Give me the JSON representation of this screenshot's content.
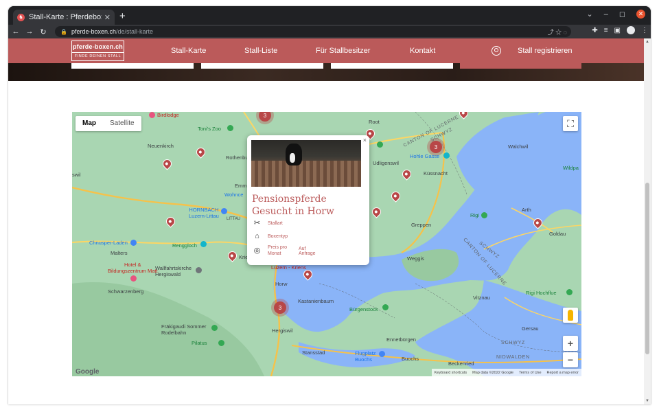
{
  "browser": {
    "tab_title": "Stall-Karte : Pferdeboxen",
    "tab_close": "✕",
    "new_tab": "+",
    "url_host": "pferde-boxen.ch",
    "url_path": "/de/stall-karte",
    "win_min": "–",
    "win_max": "◻",
    "win_close": "✕"
  },
  "header": {
    "logo_line1": "pferde-boxen.ch",
    "logo_line2": "FINDE DEINEN STALL",
    "nav": [
      "Stall-Karte",
      "Stall-Liste",
      "Für Stallbesitzer",
      "Kontakt"
    ],
    "register": "Stall registrieren"
  },
  "map": {
    "type_map": "Map",
    "type_satellite": "Satellite",
    "zoom_in": "+",
    "zoom_out": "−",
    "fullscreen": "⛶",
    "google": "Google",
    "attribution": [
      "Keyboard shortcuts",
      "Map data ©2022 Google",
      "Terms of Use",
      "Report a map error"
    ],
    "clusters": [
      "3",
      "3",
      "3"
    ],
    "places": {
      "birdlodge": "Birdlodge",
      "root": "Root",
      "tonis_zoo": "Toni's Zoo",
      "neuenkirch": "Neuenkirch",
      "rothenburg": "Rothenbu",
      "udligenswil": "Udligenswil",
      "hohle_gasse": "Hohle Gasse",
      "walchwil": "Walchwil",
      "swil": "swil",
      "emmen": "Emm",
      "wohncenter": "Wohnce",
      "kussnacht": "Küssnacht",
      "wildpark": "Wildpa",
      "hornbach": "HORNBACH\nLuzern-Littau",
      "littau": "LITTAU",
      "arth": "Arth",
      "greppen": "Greppen",
      "rigi": "Rigi",
      "goldau": "Goldau",
      "chnusper": "Chnusper-Laden",
      "renggloch": "Renggloch",
      "malters": "Malters",
      "kriens": "Krie",
      "weggis": "Weggis",
      "hotel": "Hotel &\nBildungszentrum Matt",
      "wallfahrt": "Wallfahrtskirche\nHergiswald",
      "horw": "Horw",
      "luzern_kriens": "Luzern - Kriens",
      "schwarzenberg": "Schwarzenberg",
      "kastanienbaum": "Kastanienbaum",
      "vitznau": "Vitznau",
      "rigi_hochflue": "Rigi Hochflue",
      "burgenstock": "Bürgenstock",
      "gersau": "Gersau",
      "frakigaudi": "Fräkigaudi Sommer\nRodelbahn",
      "hergiswil": "Hergiswil",
      "ennetburgen": "Ennetbürgen",
      "pilatus": "Pilatus",
      "stansstad": "Stansstad",
      "flugplatz": "Flugplatz\nBuochs",
      "buochs": "Buochs",
      "beckenried": "Beckenried",
      "canton_lucerne1": "CANTON OF LUCERNE",
      "schwyz1": "SCHWYZ",
      "schwyz2": "SCHWYZ",
      "canton_lucerne2": "CANTON OF LUCERNE",
      "schwyz3": "SCHWYZ",
      "nidwalden": "NIDWALDEN"
    }
  },
  "popup": {
    "close": "×",
    "title": "Pensionspferde Gesucht in Horw",
    "rows": [
      {
        "label": "Stallart",
        "value": ""
      },
      {
        "label": "Boxentyp",
        "value": ""
      },
      {
        "label": "Preis pro Monat",
        "value": "Auf Anfrage"
      }
    ]
  }
}
